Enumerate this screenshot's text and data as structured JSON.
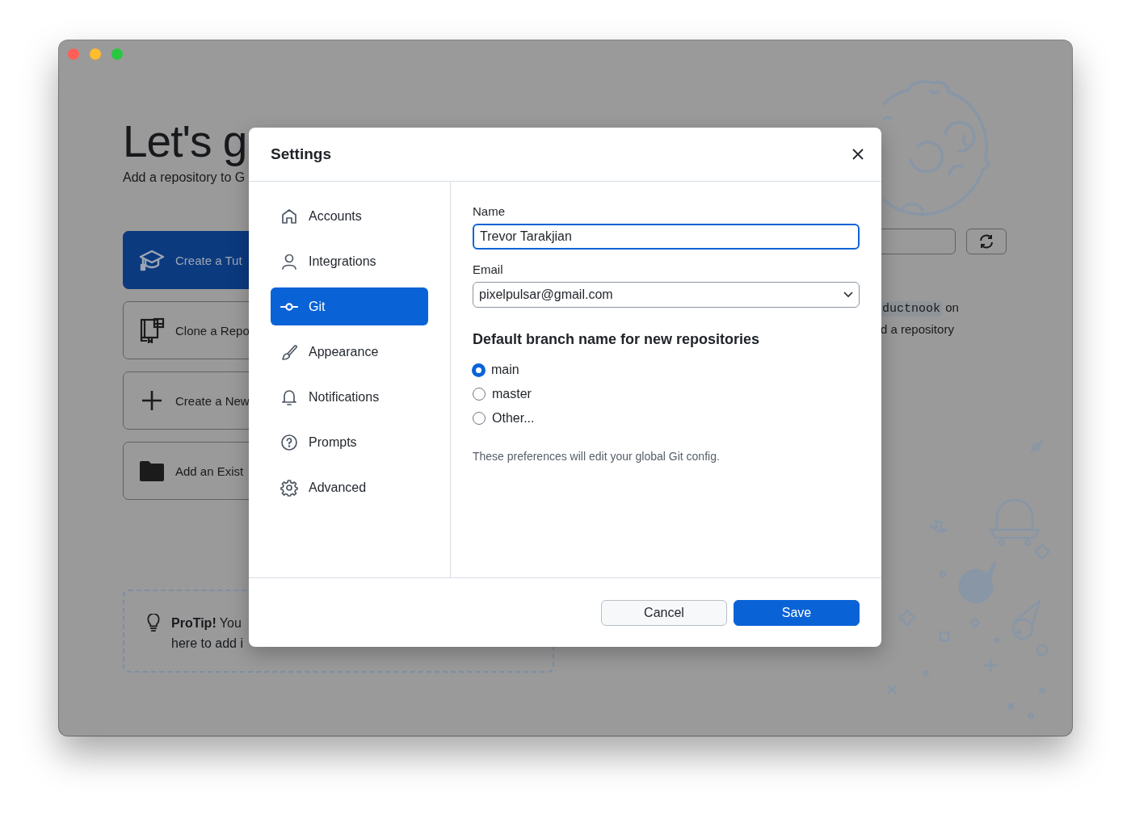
{
  "welcome": {
    "title": "Let's g",
    "subtitle": "Add a repository to G",
    "actions": [
      {
        "kind": "tutorial",
        "label": "Create a Tut",
        "primary": true
      },
      {
        "kind": "clone",
        "label": "Clone a Repo",
        "primary": false
      },
      {
        "kind": "create",
        "label": "Create a New",
        "primary": false
      },
      {
        "kind": "add",
        "label": "Add an Exist",
        "primary": false
      }
    ],
    "protip": [
      "**ProTip!** You",
      "here to add i"
    ]
  },
  "side_panel": {
    "code": "ductnook",
    "after_code": "on",
    "second_line": "d a repository"
  },
  "dialog": {
    "title": "Settings",
    "sidebar": [
      {
        "kind": "home",
        "label": "Accounts",
        "selected": false
      },
      {
        "kind": "person",
        "label": "Integrations",
        "selected": false
      },
      {
        "kind": "commit",
        "label": "Git",
        "selected": true
      },
      {
        "kind": "brush",
        "label": "Appearance",
        "selected": false
      },
      {
        "kind": "bell",
        "label": "Notifications",
        "selected": false
      },
      {
        "kind": "question",
        "label": "Prompts",
        "selected": false
      },
      {
        "kind": "gear",
        "label": "Advanced",
        "selected": false
      }
    ],
    "name": {
      "label": "Name",
      "value": "Trevor Tarakjian"
    },
    "email": {
      "label": "Email",
      "value": "pixelpulsar@gmail.com"
    },
    "branch_heading": "Default branch name for new repositories",
    "branch_options": [
      {
        "label": "main",
        "selected": true
      },
      {
        "label": "master",
        "selected": false
      },
      {
        "label": "Other...",
        "selected": false
      }
    ],
    "note": "These preferences will edit your global Git config.",
    "buttons": [
      {
        "kind": "secondary",
        "label": "Cancel"
      },
      {
        "kind": "primary",
        "label": "Save"
      }
    ]
  }
}
